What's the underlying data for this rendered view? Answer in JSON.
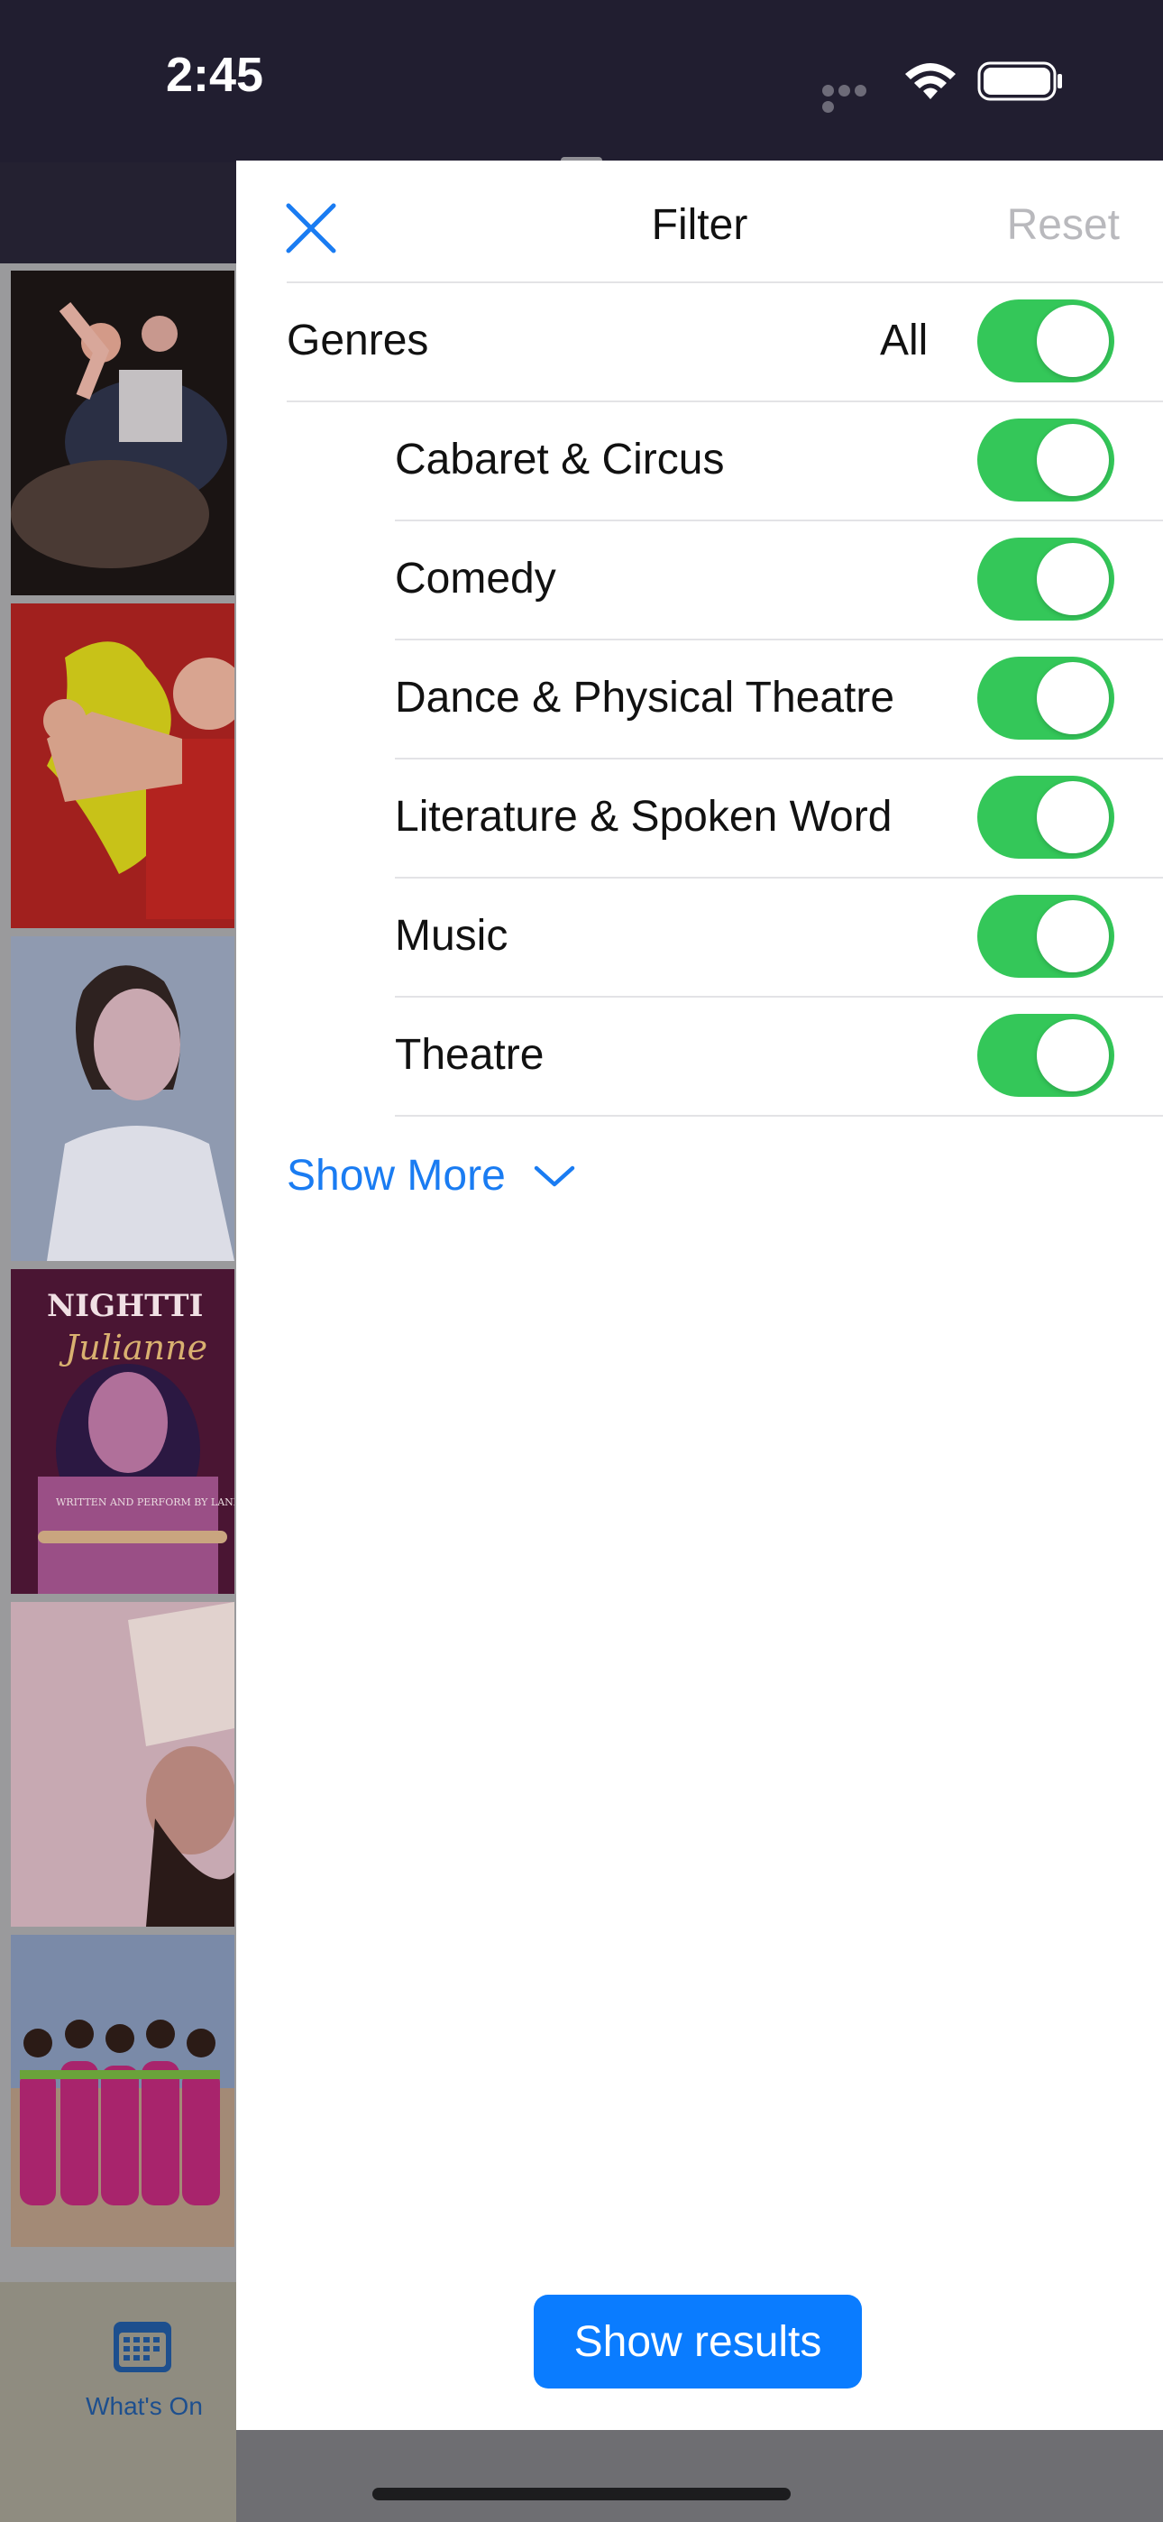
{
  "status_bar": {
    "time": "2:45"
  },
  "sheet": {
    "title": "Filter",
    "reset_label": "Reset",
    "genres_label": "Genres",
    "all_label": "All",
    "genres": [
      {
        "label": "Cabaret & Circus",
        "enabled": true
      },
      {
        "label": "Comedy",
        "enabled": true
      },
      {
        "label": "Dance & Physical Theatre",
        "enabled": true
      },
      {
        "label": "Literature & Spoken Word",
        "enabled": true
      },
      {
        "label": "Music",
        "enabled": true
      },
      {
        "label": "Theatre",
        "enabled": true
      }
    ],
    "show_more_label": "Show More",
    "show_results_label": "Show results"
  },
  "background": {
    "poster_texts": {
      "title": "NIGHTTI",
      "subtitle": "Julianne",
      "credit": "WRITTEN AND PERFORM BY LANI GOBALUZA"
    },
    "tab_label": "What's On"
  },
  "colors": {
    "accent": "#1a7cf2",
    "toggle_on": "#34c759",
    "header_bg": "#211e30"
  }
}
